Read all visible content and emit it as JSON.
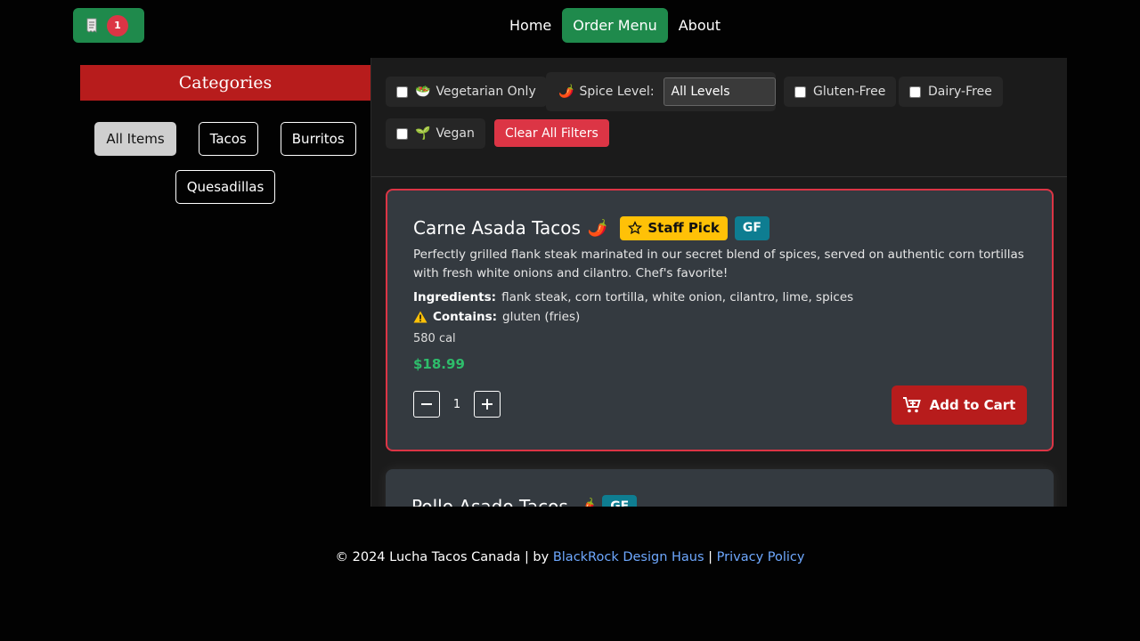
{
  "cart": {
    "count": "1",
    "icon": "receipt-icon"
  },
  "nav": {
    "links": [
      {
        "label": "Home"
      },
      {
        "label": "Order Menu"
      },
      {
        "label": "About"
      }
    ]
  },
  "sidebar": {
    "title": "Categories",
    "categories": [
      {
        "label": "All Items"
      },
      {
        "label": "Tacos"
      },
      {
        "label": "Burritos"
      },
      {
        "label": "Quesadillas"
      }
    ]
  },
  "filters": {
    "vegetarian": {
      "label": "Vegetarian Only",
      "icon": "salad-icon"
    },
    "spice": {
      "label": "Spice Level:",
      "selected": "All Levels",
      "icon": "pepper-icon"
    },
    "gluten_free": {
      "label": "Gluten-Free"
    },
    "dairy_free": {
      "label": "Dairy-Free"
    },
    "vegan": {
      "label": "Vegan",
      "icon": "seedling-icon"
    },
    "clear_label": "Clear All Filters"
  },
  "items": [
    {
      "title": "Carne Asada Tacos",
      "badge_staff": "Staff Pick",
      "badge_gf": "GF",
      "description": "Perfectly grilled flank steak marinated in our secret blend of spices, served on authentic corn tortillas with fresh white onions and cilantro. Chef's favorite!",
      "ingredients_label": "Ingredients:",
      "ingredients": "flank steak, corn tortilla, white onion, cilantro, lime, spices",
      "contains_label": "Contains:",
      "contains": "gluten (fries)",
      "calories": "580 cal",
      "price": "$18.99",
      "quantity": "1",
      "add_label": "Add to Cart"
    },
    {
      "title": "Pollo Asado Tacos",
      "badge_gf": "GF"
    }
  ],
  "footer": {
    "copyright": "© 2024 Lucha Tacos Canada | by",
    "designer": "BlackRock Design Haus",
    "sep": "|",
    "privacy": "Privacy Policy"
  },
  "colors": {
    "green": "#1f8a4c",
    "red": "#b71c1c",
    "danger": "#dc3545",
    "gold": "#ffc107",
    "teal": "#0e7d91",
    "price": "#2ebd6b"
  }
}
